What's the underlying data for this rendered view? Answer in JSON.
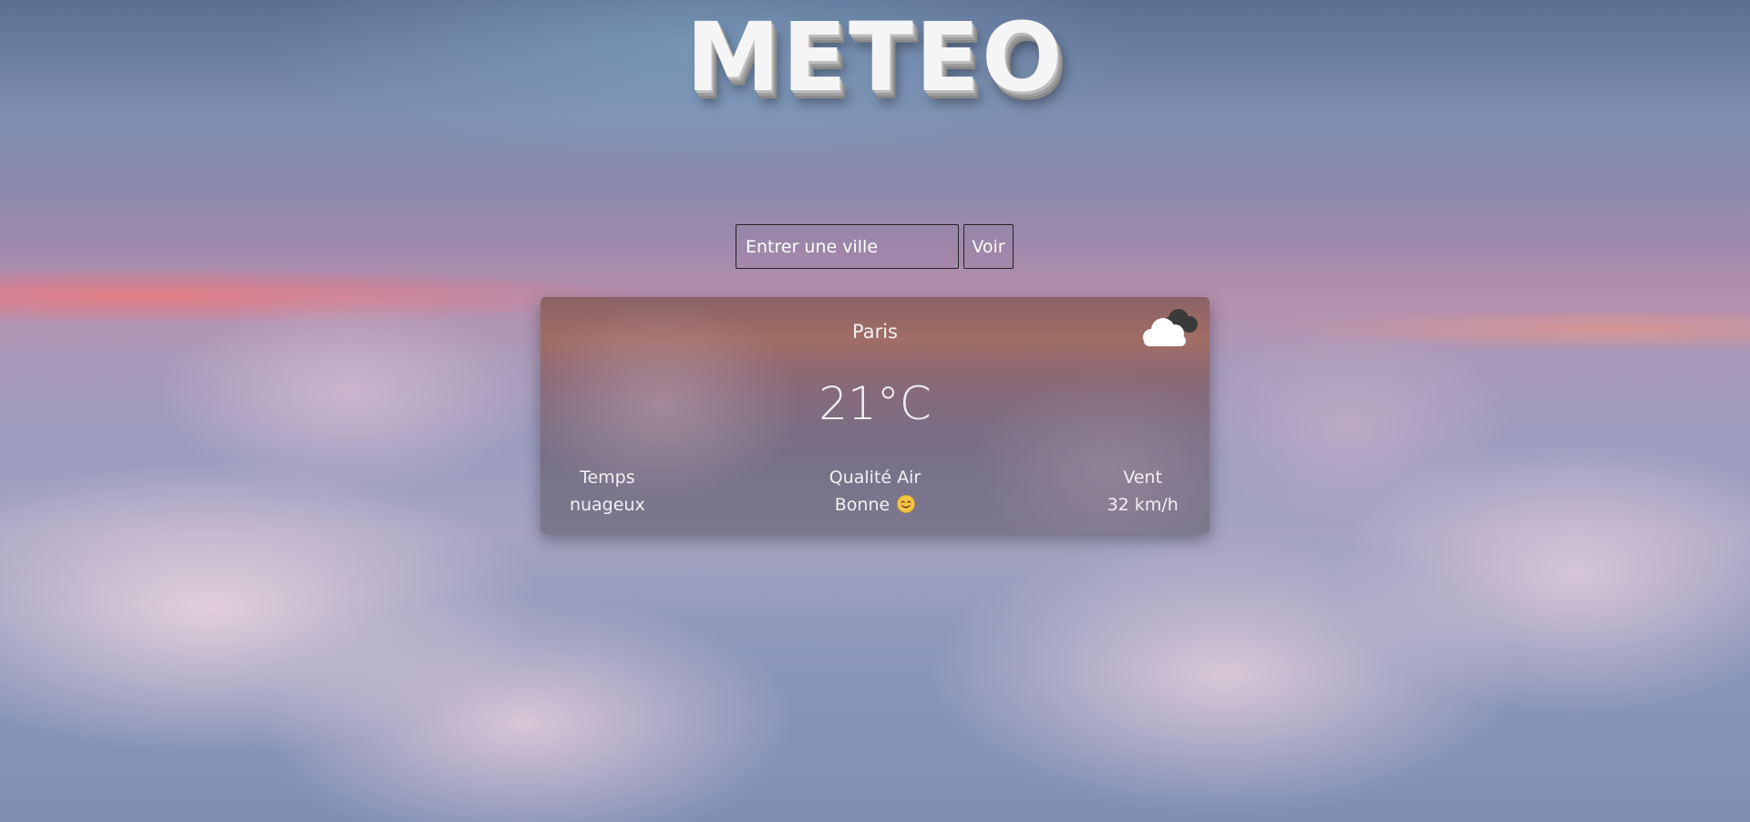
{
  "header": {
    "title": "METEO"
  },
  "search": {
    "placeholder": "Entrer une ville",
    "value": "",
    "button_label": "Voir"
  },
  "weather": {
    "city": "Paris",
    "temperature": "21°C",
    "icon": "cloud-icon",
    "details": [
      {
        "label": "Temps",
        "value": "nuageux"
      },
      {
        "label": "Qualité Air",
        "value": "Bonne",
        "icon": "smiling-face-icon"
      },
      {
        "label": "Vent",
        "value": "32 km/h"
      }
    ]
  },
  "colors": {
    "title_text": "#f5f5f5",
    "card_text": "#f3f0f4",
    "input_border": "#222222"
  }
}
